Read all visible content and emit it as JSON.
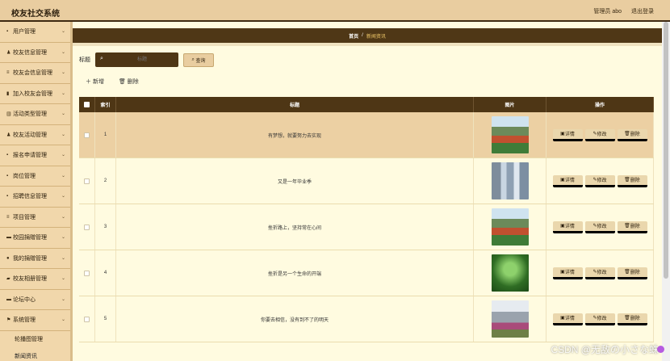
{
  "app": {
    "title": "校友社交系统"
  },
  "topbar": {
    "user": "管理员 abo",
    "logout": "退出登录"
  },
  "sidebar": {
    "items": [
      {
        "label": "用户管理",
        "icon": "grid-icon",
        "glyph": "▪"
      },
      {
        "label": "校友信息管理",
        "icon": "person-icon",
        "glyph": "♟"
      },
      {
        "label": "校友会信息管理",
        "icon": "list-icon",
        "glyph": "≡"
      },
      {
        "label": "加入校友会管理",
        "icon": "trash-icon",
        "glyph": "▮"
      },
      {
        "label": "活动类型管理",
        "icon": "bar-chart-icon",
        "glyph": "▥"
      },
      {
        "label": "校友活动管理",
        "icon": "person-icon",
        "glyph": "♟"
      },
      {
        "label": "报名申请管理",
        "icon": "grid-icon",
        "glyph": "▪"
      },
      {
        "label": "岗位管理",
        "icon": "grid-icon",
        "glyph": "▪"
      },
      {
        "label": "招聘信息管理",
        "icon": "grid-icon",
        "glyph": "▪"
      },
      {
        "label": "项目管理",
        "icon": "list-icon",
        "glyph": "≡"
      },
      {
        "label": "校园捐赠管理",
        "icon": "chat-icon",
        "glyph": "▬"
      },
      {
        "label": "我的捐赠管理",
        "icon": "location-icon",
        "glyph": "●"
      },
      {
        "label": "校友相册管理",
        "icon": "camera-icon",
        "glyph": "▰"
      },
      {
        "label": "论坛中心",
        "icon": "forum-icon",
        "glyph": "▬"
      },
      {
        "label": "系统管理",
        "icon": "flag-icon",
        "glyph": "⚑"
      }
    ],
    "subitems": [
      {
        "label": "轮播图管理"
      },
      {
        "label": "新闻资讯"
      }
    ]
  },
  "breadcrumb": {
    "home": "首页",
    "sep": "/",
    "current": "新闻资讯"
  },
  "search": {
    "label": "标题",
    "placeholder": "标题",
    "button": "查询"
  },
  "actions": {
    "add": "新增",
    "delete": "删除"
  },
  "table": {
    "headers": {
      "index": "索引",
      "title": "标题",
      "image": "图片",
      "ops": "操作"
    },
    "op_labels": {
      "detail": "详情",
      "edit": "修改",
      "delete": "删除"
    },
    "rows": [
      {
        "index": "1",
        "title": "有梦想，就要努力去实现",
        "image": "campus-track-photo"
      },
      {
        "index": "2",
        "title": "又是一年毕业季",
        "image": "campus-building-photo"
      },
      {
        "index": "3",
        "title": "挫折路上，坚持常在心间",
        "image": "campus-track-photo"
      },
      {
        "index": "4",
        "title": "挫折是另一个生命的开端",
        "image": "forest-path-photo"
      },
      {
        "index": "5",
        "title": "你要去相信，没有到不了的明天",
        "image": "campus-courtyard-photo"
      }
    ]
  },
  "watermark": "CSDN @无敌の小さな蛛",
  "colors": {
    "brand_dark": "#4e3615",
    "brand_light": "#e9cda0",
    "background": "#fffbe0"
  }
}
